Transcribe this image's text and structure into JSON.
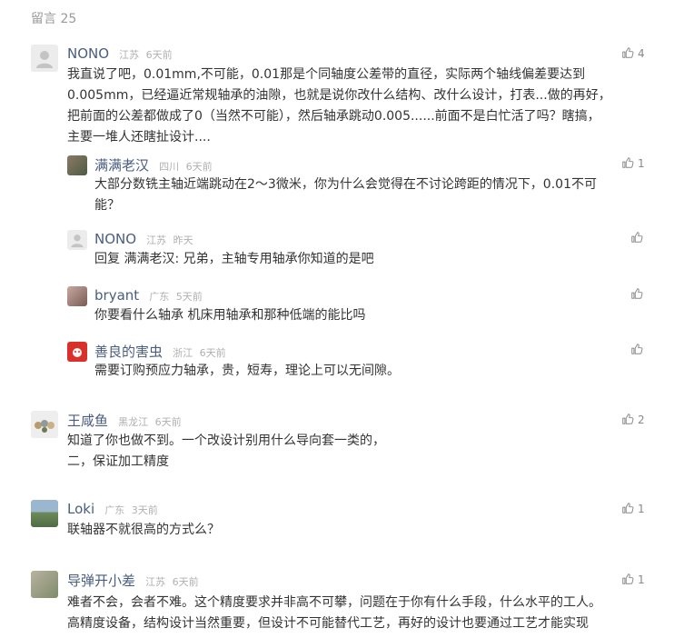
{
  "header": {
    "label": "留言",
    "count": "25"
  },
  "comments": [
    {
      "name": "NONO",
      "region": "江苏",
      "time": "6天前",
      "likes": "4",
      "avatar": "default-avatar",
      "lines": [
        "我直说了吧，0.01mm,不可能，0.01那是个同轴度公差带的直径，实际两个轴线偏差要达到",
        "0.005mm，已经逼近常规轴承的油隙，也就是说你改什么结构、改什么设计，打表...做的再好，",
        "把前面的公差都做成了0（当然不可能），然后轴承跳动0.005......前面不是白忙活了吗？瞎搞，",
        "主要一堆人还瞎扯设计...."
      ],
      "replies": [
        {
          "name": "满满老汉",
          "region": "四川",
          "time": "6天前",
          "likes": "1",
          "avatar": "photo-avatar",
          "lines": [
            "大部分数铣主轴近端跳动在2～3微米，你为什么会觉得在不讨论跨距的情况下，0.01不可",
            "能？"
          ]
        },
        {
          "name": "NONO",
          "region": "江苏",
          "time": "昨天",
          "likes": "",
          "avatar": "default-avatar",
          "lines": [
            "回复 满满老汉: 兄弟，主轴专用轴承你知道的是吧"
          ]
        },
        {
          "name": "bryant",
          "region": "广东",
          "time": "5天前",
          "likes": "",
          "avatar": "photo-avatar",
          "lines": [
            "你要看什么轴承 机床用轴承和那种低端的能比吗"
          ]
        },
        {
          "name": "善良的害虫",
          "region": "浙江",
          "time": "6天前",
          "likes": "",
          "avatar": "red-avatar",
          "lines": [
            "需要订购预应力轴承，贵，短寿，理论上可以无间隙。"
          ]
        }
      ]
    },
    {
      "name": "王咸鱼",
      "region": "黑龙江",
      "time": "6天前",
      "likes": "2",
      "avatar": "photo-avatar",
      "lines": [
        "知道了你也做不到。一个改设计别用什么导向套一类的，",
        "二，保证加工精度"
      ]
    },
    {
      "name": "Loki",
      "region": "广东",
      "time": "3天前",
      "likes": "1",
      "avatar": "photo-avatar",
      "lines": [
        "联轴器不就很高的方式么？"
      ]
    },
    {
      "name": "导弹开小差",
      "region": "江苏",
      "time": "6天前",
      "likes": "1",
      "avatar": "photo-avatar",
      "lines": [
        "难者不会，会者不难。这个精度要求并非高不可攀，问题在于你有什么手段，什么水平的工人。",
        "高精度设备，结构设计当然重要，但设计不可能替代工艺，再好的设计也要通过工艺才能实现"
      ]
    }
  ]
}
